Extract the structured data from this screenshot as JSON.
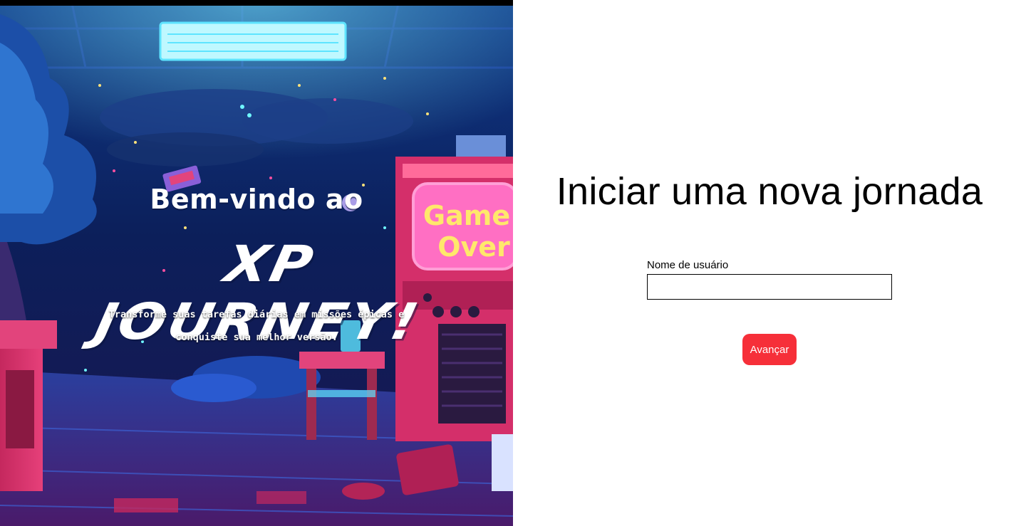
{
  "hero": {
    "welcome": "Bem-vindo ao",
    "brand": "XP JOURNEY!",
    "tagline_line1": "Transforme suas tarefas diárias em missões épicas e",
    "tagline_line2": "conquiste sua melhor versão.",
    "arcade_screen_line1": "Game",
    "arcade_screen_line2": "Over"
  },
  "form": {
    "title": "Iniciar uma nova jornada",
    "username_label": "Nome de usuário",
    "username_value": "",
    "submit_label": "Avançar"
  },
  "colors": {
    "accent": "#f62f39",
    "hero_base": "#0b1b4a"
  }
}
